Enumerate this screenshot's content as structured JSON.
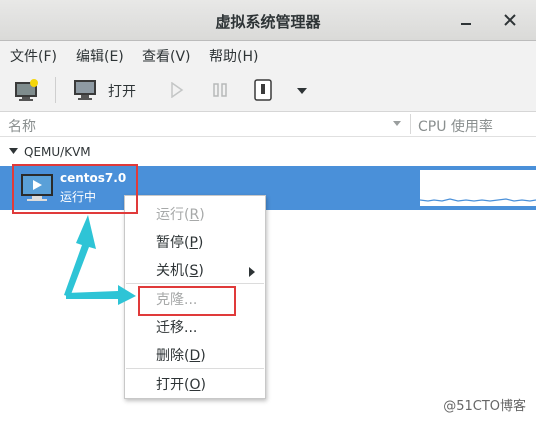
{
  "window": {
    "title": "虚拟系统管理器"
  },
  "menubar": {
    "items": [
      {
        "label": "文件(F)"
      },
      {
        "label": "编辑(E)"
      },
      {
        "label": "查看(V)"
      },
      {
        "label": "帮助(H)"
      }
    ]
  },
  "toolbar": {
    "open_label": "打开"
  },
  "list": {
    "columns": {
      "name": "名称",
      "cpu": "CPU 使用率"
    },
    "group": {
      "label": "QEMU/KVM"
    },
    "vm": {
      "name": "centos7.0",
      "status": "运行中"
    }
  },
  "context_menu": {
    "run": {
      "label": "运行(",
      "key": "R",
      "suffix": ")"
    },
    "pause": {
      "label": "暂停(",
      "key": "P",
      "suffix": ")"
    },
    "shutdown": {
      "label": "关机(",
      "key": "S",
      "suffix": ")"
    },
    "clone": {
      "label": "克隆..."
    },
    "migrate": {
      "label": "迁移..."
    },
    "delete": {
      "label": "删除(",
      "key": "D",
      "suffix": ")"
    },
    "open": {
      "label": "打开(",
      "key": "O",
      "suffix": ")"
    }
  },
  "watermark": {
    "text": "@51CTO博客"
  },
  "colors": {
    "selection": "#4a90d9",
    "highlight_box": "#e03a3a",
    "annotation_arrow": "#2ec4d6"
  },
  "icons": [
    "close-icon",
    "minimize-icon",
    "new-vm-icon",
    "monitor-icon",
    "play-icon",
    "pause-icon",
    "power-icon",
    "dropdown-arrow-icon",
    "vm-screen-icon"
  ]
}
